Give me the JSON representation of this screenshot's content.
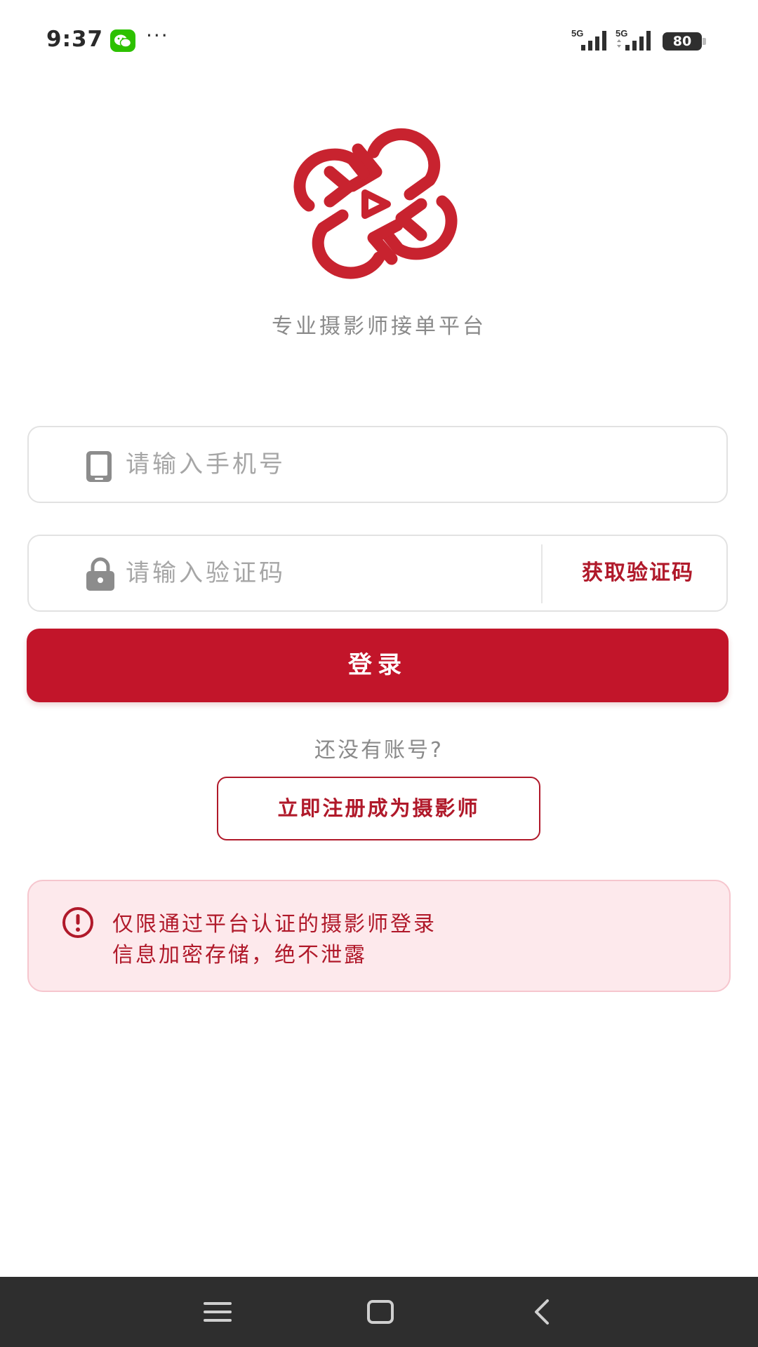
{
  "status_bar": {
    "time": "9:37",
    "network_1": "5G",
    "network_2": "5G",
    "battery": "80",
    "icons": [
      "wechat-icon",
      "more-icon",
      "signal-icon",
      "signal-icon",
      "battery-icon"
    ]
  },
  "brand": {
    "tagline": "专业摄影师接单平台",
    "logo_color": "#c8232f"
  },
  "form": {
    "phone": {
      "placeholder": "请输入手机号",
      "value": "",
      "icon": "phone-icon"
    },
    "code": {
      "placeholder": "请输入验证码",
      "value": "",
      "icon": "lock-icon"
    },
    "get_code_label": "获取验证码",
    "login_label": "登录"
  },
  "register": {
    "prompt": "还没有账号?",
    "button_label": "立即注册成为摄影师"
  },
  "notice": {
    "icon": "alert-icon",
    "line_1": "仅限通过平台认证的摄影师登录",
    "line_2": "信息加密存储，绝不泄露"
  },
  "nav_bar": {
    "buttons": [
      "menu-icon",
      "home-icon",
      "back-icon"
    ]
  },
  "colors": {
    "accent": "#c2152a",
    "accent_text": "#b0192a",
    "notice_bg": "#fde9ec",
    "muted_text": "#8a8a8a"
  }
}
